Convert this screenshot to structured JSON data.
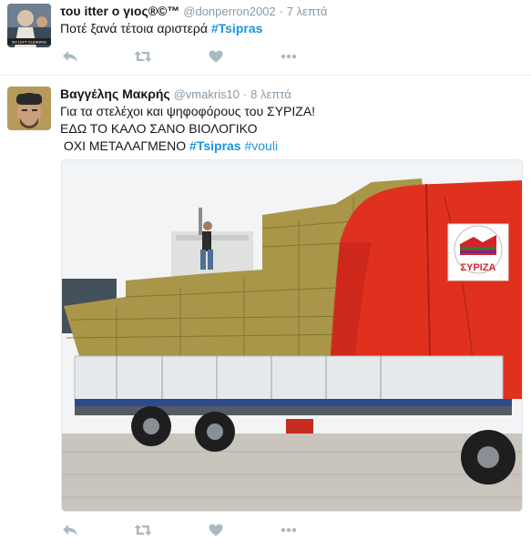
{
  "tweets": [
    {
      "name": "του itter ο γιος®©™",
      "handle": "@donperron2002",
      "time": "7 λεπτά",
      "text_plain": "Ποτέ ξανά τέτοια αριστερά ",
      "hashtag": "#Tsipras",
      "avatar_text": "NO LEFT CLEANING"
    },
    {
      "name": "Βαγγέλης Μακρής",
      "handle": "@vmakris10",
      "time": "8 λεπτά",
      "line1": "Για τα στελέχοι και ψηφοφόρους του ΣΥΡΙΖΑ!",
      "line2": "ΕΔΩ ΤΟ ΚΑΛΟ ΣΑΝΟ ΒΙΟΛΟΓΙΚΟ",
      "line3_plain": " ΟΧΙ ΜΕΤΑΛΑΓΜΕΝΟ ",
      "hashtag1": "#Tsipras",
      "hashtag2": "#vouli",
      "logo_text": "ΣΥΡΙΖΑ"
    }
  ],
  "separator": "·",
  "icons": [
    "reply-icon",
    "retweet-icon",
    "like-icon",
    "more-icon"
  ],
  "colors": {
    "hashtag": "#1b95e0",
    "muted": "#8899a6",
    "tarp": "#e0301e"
  }
}
